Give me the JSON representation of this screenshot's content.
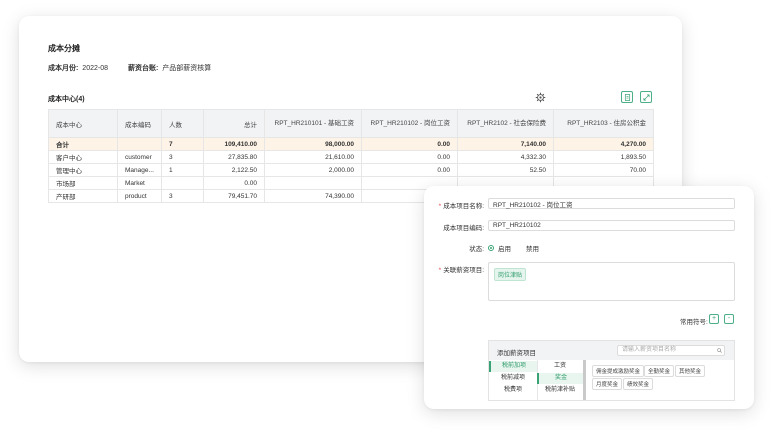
{
  "report": {
    "title": "成本分摊",
    "month_label": "成本月份:",
    "month_value": "2022-08",
    "ledger_label": "薪资台账:",
    "ledger_value": "产品部薪资核算",
    "section_title": "成本中心(4)",
    "icons": {
      "settings": "gear-icon",
      "export": "excel-export-icon",
      "fullscreen": "expand-icon"
    }
  },
  "table": {
    "headers": [
      "成本中心",
      "成本编码",
      "人数",
      "总计",
      "RPT_HR210101 - 基础工资",
      "RPT_HR210102 - 岗位工资",
      "RPT_HR2102 - 社会保险费",
      "RPT_HR2103 - 住房公积金"
    ],
    "total": [
      "合计",
      "",
      "7",
      "109,410.00",
      "98,000.00",
      "0.00",
      "7,140.00",
      "4,270.00"
    ],
    "rows": [
      [
        "客户中心",
        "customer",
        "3",
        "27,835.80",
        "21,610.00",
        "0.00",
        "4,332.30",
        "1,893.50"
      ],
      [
        "管理中心",
        "Manage...",
        "1",
        "2,122.50",
        "2,000.00",
        "0.00",
        "52.50",
        "70.00"
      ],
      [
        "市场部",
        "Market",
        "",
        "0.00",
        "",
        "",
        "",
        ""
      ],
      [
        "产研部",
        "product",
        "3",
        "79,451.70",
        "74,390.00",
        "",
        "",
        ""
      ]
    ]
  },
  "dialog": {
    "name_label": "成本项目名称:",
    "name_value": "RPT_HR210102 - 岗位工资",
    "code_label": "成本项目编码:",
    "code_value": "RPT_HR210102",
    "status_label": "状态:",
    "status_enabled": "启用",
    "status_disabled": "禁用",
    "related_label": "关联薪资项目:",
    "related_tag": "岗位津贴",
    "symbols_label": "常用符号:",
    "plus": "+",
    "minus": "-",
    "picker": {
      "title": "添加薪资项目",
      "search_placeholder": "请输入薪资项目名称",
      "col1": [
        "税前加项",
        "税前减项",
        "税费项"
      ],
      "col2": [
        "工资",
        "奖金",
        "税前津补贴"
      ],
      "chips_row1": [
        "佣金提成激励奖金",
        "全勤奖金",
        "其他奖金"
      ],
      "chips_row2": [
        "月度奖金",
        "绩效奖金"
      ]
    }
  }
}
